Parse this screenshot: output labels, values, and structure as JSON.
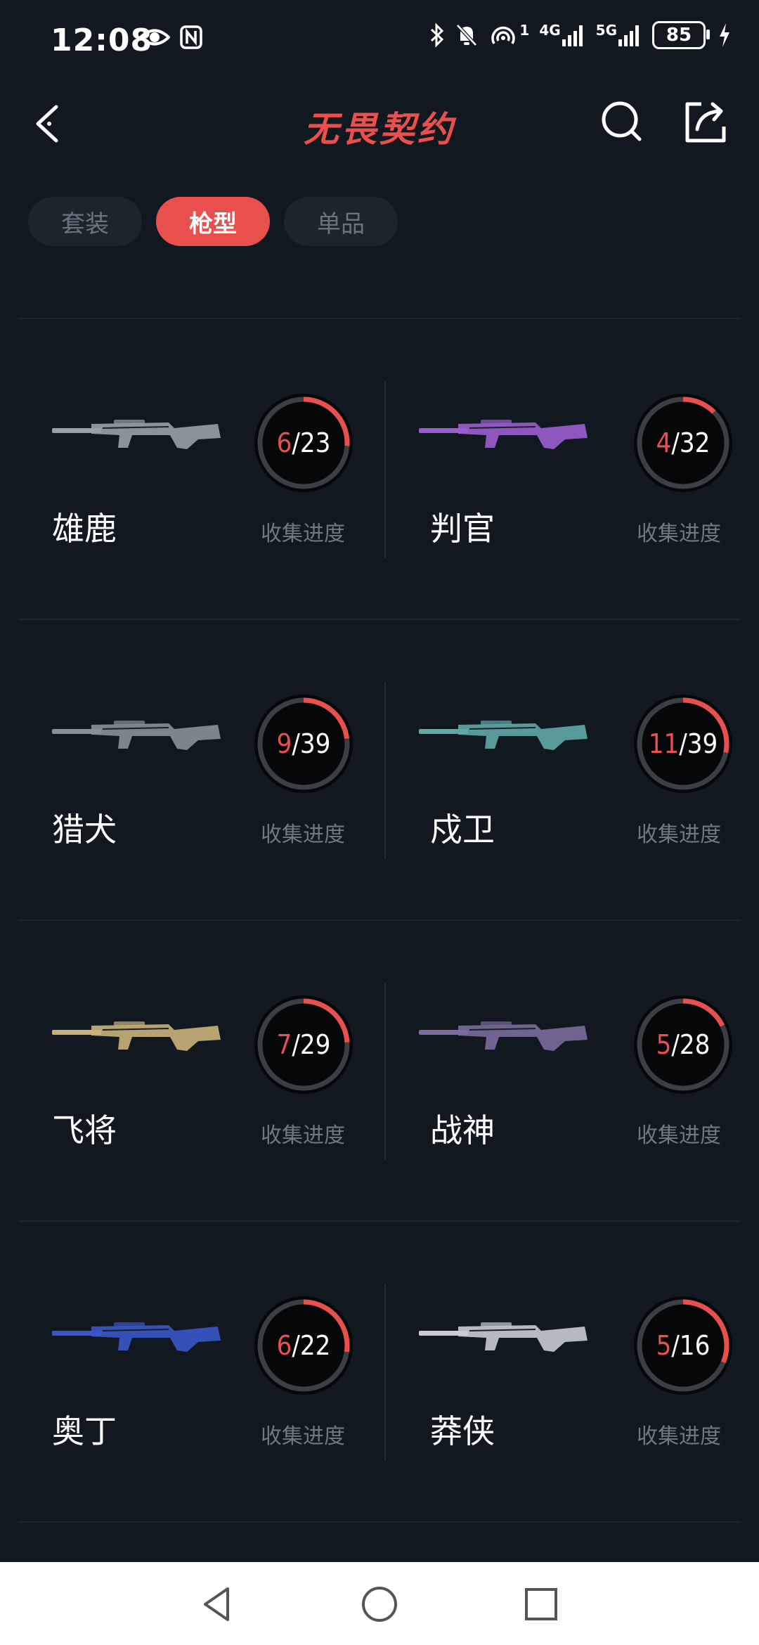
{
  "status": {
    "time": "12:08",
    "network_4g": "4G",
    "network_5g": "5G",
    "hotspot_sup": "1",
    "battery": "85"
  },
  "header": {
    "title": "无畏契约"
  },
  "tabs": [
    {
      "label": "套装",
      "active": false
    },
    {
      "label": "枪型",
      "active": true
    },
    {
      "label": "单品",
      "active": false
    }
  ],
  "colors": {
    "accent": "#e9504d",
    "background": "#111820",
    "tab_bg": "#1c242c",
    "ring_track": "#3a3f45"
  },
  "progress_label": "收集进度",
  "weapons": [
    {
      "name": "雄鹿",
      "collected": 6,
      "total": 23,
      "collected_text": "6",
      "total_text": "23",
      "gun_color": "#9aa0a8"
    },
    {
      "name": "判官",
      "collected": 4,
      "total": 32,
      "collected_text": "4",
      "total_text": "32",
      "gun_color": "#9b5ed0"
    },
    {
      "name": "猎犬",
      "collected": 9,
      "total": 39,
      "collected_text": "9",
      "total_text": "39",
      "gun_color": "#8a9098"
    },
    {
      "name": "戍卫",
      "collected": 11,
      "total": 39,
      "collected_text": "11",
      "total_text": "39",
      "gun_color": "#5fa8a6"
    },
    {
      "name": "飞将",
      "collected": 7,
      "total": 29,
      "collected_text": "7",
      "total_text": "29",
      "gun_color": "#c9b27a"
    },
    {
      "name": "战神",
      "collected": 5,
      "total": 28,
      "collected_text": "5",
      "total_text": "28",
      "gun_color": "#7a6c9c"
    },
    {
      "name": "奥丁",
      "collected": 6,
      "total": 22,
      "collected_text": "6",
      "total_text": "22",
      "gun_color": "#3a56c8"
    },
    {
      "name": "莽侠",
      "collected": 5,
      "total": 16,
      "collected_text": "5",
      "total_text": "16",
      "gun_color": "#c8ccd2"
    }
  ],
  "icons": {
    "back": "chevron-left-icon",
    "search": "search-icon",
    "share": "share-icon",
    "nav_back": "triangle-back-icon",
    "nav_home": "circle-home-icon",
    "nav_recent": "square-recent-icon"
  }
}
